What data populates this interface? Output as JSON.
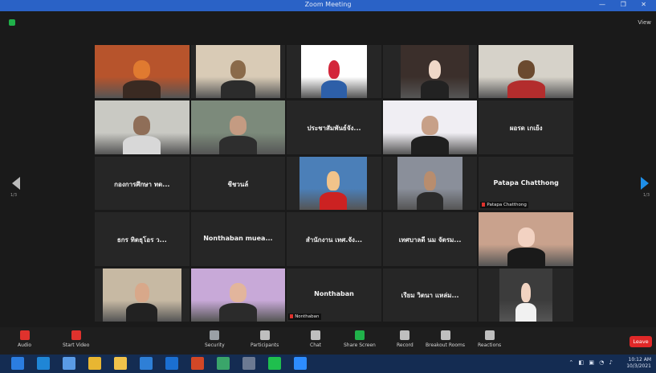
{
  "window": {
    "title": "Zoom Meeting",
    "controls": "— ❐ ✕"
  },
  "view_button": "View",
  "nav": {
    "prev_page": "1/3",
    "next_page": "1/3"
  },
  "tiles": [
    {
      "label": "",
      "bg": "#b7542c"
    },
    {
      "label": "",
      "bg": "#d9cbb6"
    },
    {
      "label": "",
      "bg": "#ffffff"
    },
    {
      "label": "",
      "bg": "#3b2f2b"
    },
    {
      "label": "",
      "bg": "#d6d2c9"
    },
    {
      "label": "",
      "bg": "#c9c9c3"
    },
    {
      "label": "",
      "bg": "#7c8a7b"
    },
    {
      "name": "ประชาสัมพันธ์จัง...",
      "label": ""
    },
    {
      "label": "",
      "bg": "#f0eef3"
    },
    {
      "name": "ผอรด เกเย้ง",
      "label": ""
    },
    {
      "name": "กองการศึกษา ทด...",
      "label": ""
    },
    {
      "name": "ชีชวนล์",
      "label": ""
    },
    {
      "label": "",
      "bg": "#4b7fb8"
    },
    {
      "label": "",
      "bg": "#8a8f9a"
    },
    {
      "name": "Patapa Chatthong",
      "label": "Patapa Chatthong"
    },
    {
      "name": "ธกร ทิตธุโอร ว...",
      "label": ""
    },
    {
      "name": "Nonthaban muea...",
      "label": ""
    },
    {
      "name": "สำนักงาน เทศ.จัง...",
      "label": ""
    },
    {
      "name": "เทศบาลดี นม จัตรม...",
      "label": ""
    },
    {
      "label": "",
      "bg": "#c9a28d"
    },
    {
      "label": "",
      "bg": "#c7b9a3"
    },
    {
      "label": "",
      "bg": "#c8a9d8"
    },
    {
      "name": "Nonthaban",
      "label": "Nonthaban"
    },
    {
      "name": "เรียม วิตนา แหล่ม...",
      "label": ""
    },
    {
      "label": "",
      "bg": "#3c3c3c"
    }
  ],
  "toolbar": {
    "items": [
      {
        "label": "Audio",
        "color": "#e0322d"
      },
      {
        "label": "Start Video",
        "color": "#e0322d"
      },
      {
        "label": "Security",
        "color": "#9aa0a6"
      },
      {
        "label": "Participants",
        "color": "#bfbfbf"
      },
      {
        "label": "Chat",
        "color": "#bfbfbf"
      },
      {
        "label": "Share Screen",
        "color": "#20b14a"
      },
      {
        "label": "Record",
        "color": "#bfbfbf"
      },
      {
        "label": "Breakout Rooms",
        "color": "#bfbfbf"
      },
      {
        "label": "Reactions",
        "color": "#bfbfbf"
      }
    ],
    "end_label": "Leave"
  },
  "taskbar": {
    "apps": [
      "windows-icon",
      "edge-icon",
      "store-icon",
      "chrome-icon",
      "explorer-icon",
      "mail-icon",
      "photos-icon",
      "powerpoint-icon",
      "media-icon",
      "tool-icon",
      "line-icon",
      "zoom-icon"
    ],
    "tray_text": "⌃ ◧ ▣ ◔ ♪",
    "time": "10:12 AM",
    "date": "10/3/2021"
  }
}
